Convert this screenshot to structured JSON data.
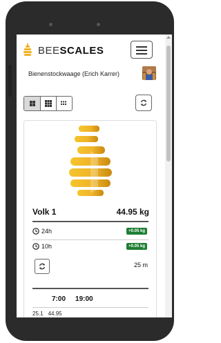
{
  "brand": {
    "part1": "BEE",
    "part2": "SCALES",
    "accent": "#f0b429"
  },
  "header": {
    "scale_name": "Bienenstockwaage (Erich Karrer)"
  },
  "views": [
    {
      "name": "single",
      "icon": "square-icon",
      "active": true
    },
    {
      "name": "grid",
      "icon": "grid-icon",
      "active": false
    },
    {
      "name": "list",
      "icon": "list-grid-icon",
      "active": false
    }
  ],
  "hive": {
    "name": "Volk 1",
    "weight": "44.95 kg",
    "changes": [
      {
        "period": "24h",
        "delta": "+0.05 kg"
      },
      {
        "period": "10h",
        "delta": "+0.05 kg"
      }
    ],
    "elapsed": "25 m",
    "times": [
      "7:00",
      "19:00"
    ],
    "data_row": [
      "25.1",
      "44.95"
    ]
  },
  "colors": {
    "badge": "#1e7e34",
    "honey": "#f0b429"
  }
}
